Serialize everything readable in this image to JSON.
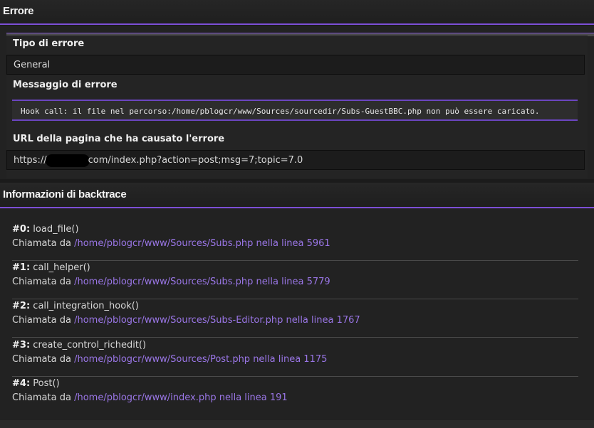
{
  "error_section": {
    "header": "Errore",
    "type_label": "Tipo di errore",
    "type_value": "General",
    "message_label": "Messaggio di errore",
    "message_value": "Hook call: il file nel percorso:/home/pblogcr/www/Sources/sourcedir/Subs-GuestBBC.php non può essere caricato.",
    "url_label": "URL della pagina che ha causato l'errore",
    "url_prefix": "https://",
    "url_suffix": "com/index.php?action=post;msg=7;topic=7.0"
  },
  "backtrace": {
    "header": "Informazioni di backtrace",
    "called_from_label": "Chiamata da",
    "frames": [
      {
        "num": "#0",
        "func": "load_file()",
        "location": "/home/pblogcr/www/Sources/Subs.php nella linea 5961"
      },
      {
        "num": "#1",
        "func": "call_helper()",
        "location": "/home/pblogcr/www/Sources/Subs.php nella linea 5779"
      },
      {
        "num": "#2",
        "func": "call_integration_hook()",
        "location": "/home/pblogcr/www/Sources/Subs-Editor.php nella linea 1767"
      },
      {
        "num": "#3",
        "func": "create_control_richedit()",
        "location": "/home/pblogcr/www/Sources/Post.php nella linea 1175"
      },
      {
        "num": "#4",
        "func": "Post()",
        "location": "/home/pblogcr/www/index.php nella linea 191"
      }
    ]
  },
  "colors": {
    "accent": "#7c4fd6",
    "link": "#9a76e6",
    "background": "#1b1b1b"
  }
}
